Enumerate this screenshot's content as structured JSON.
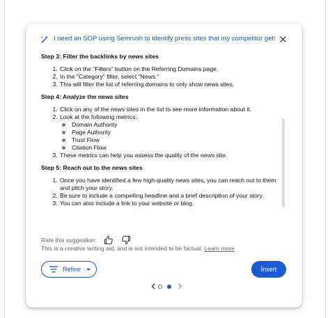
{
  "header": {
    "prompt": "I need an SOP using Semrush to identify press sites that my competitor gets links f",
    "close_icon": "close-icon",
    "pen_icon": "pen-sparkle-icon"
  },
  "content": {
    "step3": {
      "title": "Step 3: Filter the backlinks by news sites",
      "items": [
        "Click on the \"Filters\" button on the Referring Domains page.",
        "In the \"Category\" filter, select \"News.\"",
        "This will filter the list of referring domains to only show news sites."
      ]
    },
    "step4": {
      "title": "Step 4: Analyze the news sites",
      "item1": "Click on any of the news sites in the list to see more information about it.",
      "item2": "Look at the following metrics:",
      "metrics": [
        "Domain Authority",
        "Page Authority",
        "Trust Flow",
        "Citation Flow"
      ],
      "item3": "These metrics can help you assess the quality of the news site."
    },
    "step5": {
      "title": "Step 5: Reach out to the news sites",
      "items": [
        "Once you have identified a few high-quality news sites, you can reach out to them and pitch your story.",
        "Be sure to include a compelling headline and a brief description of your story.",
        "You can also include a link to your website or blog."
      ]
    }
  },
  "feedback": {
    "rate_label": "Rate this suggestion:",
    "disclaimer": "This is a creative writing aid, and is not intended to be factual.",
    "learn_more": "Learn more"
  },
  "actions": {
    "refine_label": "Refine",
    "insert_label": "Insert"
  },
  "colors": {
    "accent": "#1b5bd1",
    "link_text": "#1a56c4",
    "muted_text": "#5f6368"
  },
  "pager": {
    "total": 2,
    "current": 2
  }
}
